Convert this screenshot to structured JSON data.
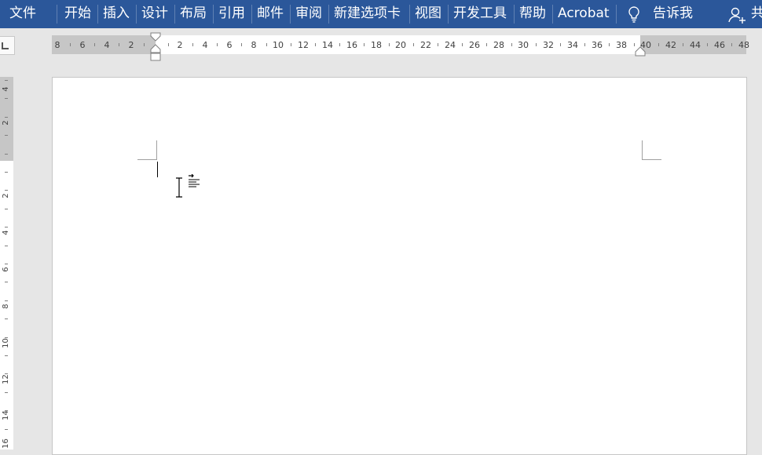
{
  "ribbon": {
    "tabs": [
      {
        "label": "文件"
      },
      {
        "label": "开始"
      },
      {
        "label": "插入"
      },
      {
        "label": "设计"
      },
      {
        "label": "布局"
      },
      {
        "label": "引用"
      },
      {
        "label": "邮件"
      },
      {
        "label": "审阅"
      },
      {
        "label": "新建选项卡"
      },
      {
        "label": "视图"
      },
      {
        "label": "开发工具"
      },
      {
        "label": "帮助"
      },
      {
        "label": "Acrobat"
      }
    ],
    "tell_me": "告诉我",
    "share": "共",
    "bg_color": "#2b579a",
    "tell_me_icon": "lightbulb-icon",
    "share_icon": "person-add-icon"
  },
  "horizontal_ruler": {
    "numbers": [
      "8",
      "6",
      "4",
      "2",
      "2",
      "4",
      "6",
      "8",
      "10",
      "12",
      "14",
      "16",
      "18",
      "20",
      "22",
      "24",
      "26",
      "28",
      "30",
      "32",
      "34",
      "36",
      "38",
      "40",
      "42",
      "44",
      "46",
      "48"
    ]
  },
  "vertical_ruler": {
    "numbers": [
      "4",
      "2",
      "2",
      "4",
      "6",
      "8",
      "10",
      "12",
      "14",
      "16"
    ]
  }
}
